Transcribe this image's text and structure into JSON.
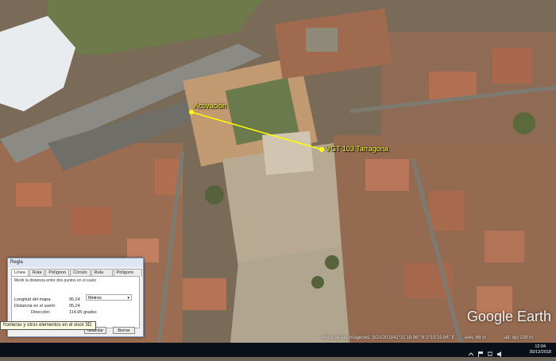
{
  "placemarks": {
    "start_label": "Activación",
    "end_label": "VGT 103 Tarragona"
  },
  "watermark": "Google Earth",
  "status_bar": {
    "imagery_date": "fecha de las imágenes: 3/21/2018",
    "coords": "41°11'18.96\" N 1°15'19.84\" E",
    "elevation": "elev. 66 m",
    "eye_alt": "alt. ojo 239 m"
  },
  "ruler": {
    "title": "Regla",
    "tabs": [
      "Línea",
      "Ruta",
      "Polígono",
      "Círculo",
      "Ruta 3D",
      "Polígono 3D"
    ],
    "active_tab": "Línea",
    "description": "Medir la distancia entre dos puntos en el suelo",
    "map_length_label": "Longitud del mapa:",
    "map_length_value": "95,24",
    "unit_selected": "Metros",
    "ground_length_label": "Distancia en el suelo:",
    "ground_length_value": "95,24",
    "heading_label": "Dirección:",
    "heading_value": "114,95 grados",
    "save_button": "Guardar",
    "clear_button": "Borrar"
  },
  "tooltip": "fronteras y otros elementos en el visor 3D.",
  "clock": {
    "time": "12:04",
    "date": "30/12/2018"
  },
  "colors": {
    "measure_line": "#ffff00",
    "taskbar": "#0a0f18"
  }
}
